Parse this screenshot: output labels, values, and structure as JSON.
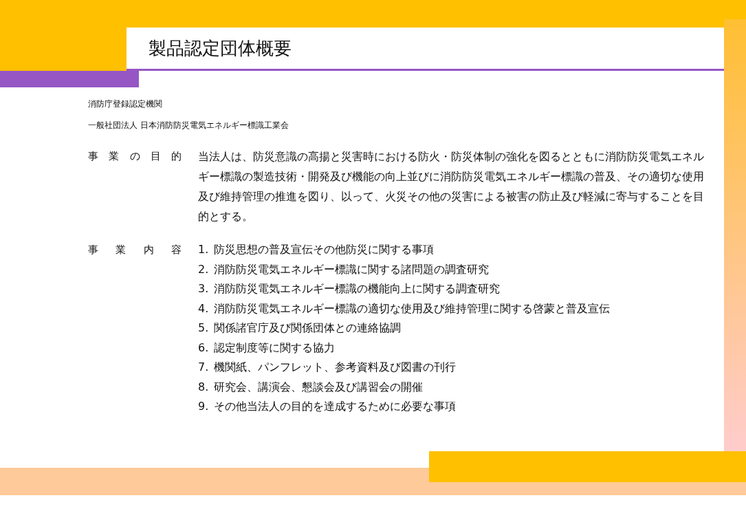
{
  "header": {
    "title": "製品認定団体概要"
  },
  "organization": {
    "registration": "消防庁登録認定機関",
    "name": "一般社団法人 日本消防防災電気エネルギー標識工業会"
  },
  "sections": [
    {
      "kind": "paragraph",
      "label": "事業の目的",
      "text": "当法人は、防災意識の高揚と災害時における防火・防災体制の強化を図るとともに消防防災電気エネルギー標識の製造技術・開発及び機能の向上並びに消防防災電気エネルギー標識の普及、その適切な使用及び維持管理の推進を図り、以って、火災その他の災害による被害の防止及び軽減に寄与することを目的とする。"
    },
    {
      "kind": "list",
      "label": "事業内容",
      "items": [
        {
          "number": "1.",
          "text": "防災思想の普及宣伝その他防災に関する事項"
        },
        {
          "number": "2.",
          "text": "消防防災電気エネルギー標識に関する諸問題の調査研究"
        },
        {
          "number": "3.",
          "text": "消防防災電気エネルギー標識の機能向上に関する調査研究"
        },
        {
          "number": "4.",
          "text": "消防防災電気エネルギー標識の適切な使用及び維持管理に関する啓蒙と普及宣伝"
        },
        {
          "number": "5.",
          "text": "関係諸官庁及び関係団体との連絡協調"
        },
        {
          "number": "6.",
          "text": "認定制度等に関する協力"
        },
        {
          "number": "7.",
          "text": "機関紙、パンフレット、参考資料及び図書の刊行"
        },
        {
          "number": "8.",
          "text": "研究会、講演会、懇談会及び講習会の開催"
        },
        {
          "number": "9.",
          "text": "その他当法人の目的を達成するために必要な事項"
        }
      ]
    }
  ]
}
